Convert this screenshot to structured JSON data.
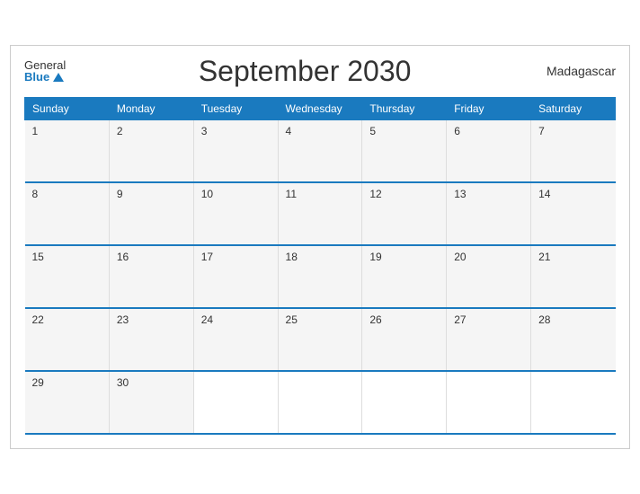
{
  "header": {
    "logo_general": "General",
    "logo_blue": "Blue",
    "title": "September 2030",
    "country": "Madagascar"
  },
  "weekdays": [
    "Sunday",
    "Monday",
    "Tuesday",
    "Wednesday",
    "Thursday",
    "Friday",
    "Saturday"
  ],
  "weeks": [
    [
      1,
      2,
      3,
      4,
      5,
      6,
      7
    ],
    [
      8,
      9,
      10,
      11,
      12,
      13,
      14
    ],
    [
      15,
      16,
      17,
      18,
      19,
      20,
      21
    ],
    [
      22,
      23,
      24,
      25,
      26,
      27,
      28
    ],
    [
      29,
      30,
      null,
      null,
      null,
      null,
      null
    ]
  ]
}
